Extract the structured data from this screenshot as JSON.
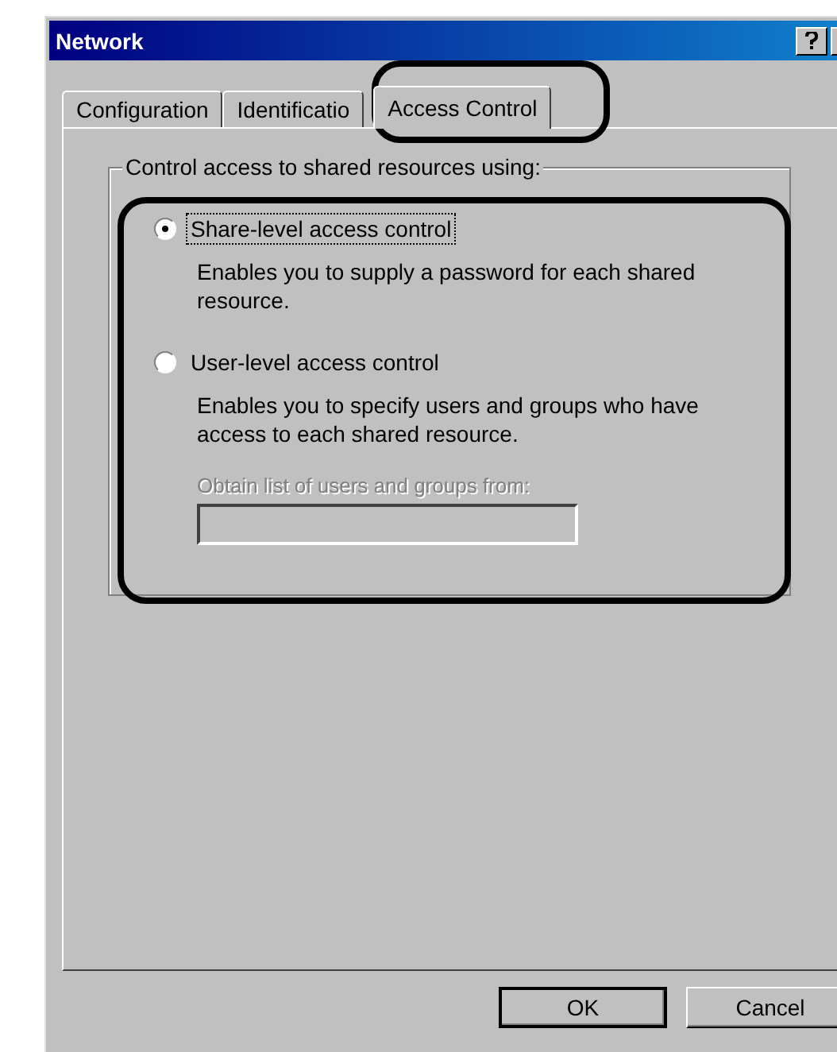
{
  "window": {
    "title": "Network"
  },
  "tabs": [
    {
      "label": "Configuration",
      "selected": false
    },
    {
      "label": "Identificatio",
      "selected": false
    },
    {
      "label": "Access Control",
      "selected": true
    }
  ],
  "group": {
    "title": "Control access to shared resources using:",
    "options": [
      {
        "label": "Share-level access control",
        "selected": true,
        "description": "Enables you to supply a password for each shared resource."
      },
      {
        "label": "User-level access control",
        "selected": false,
        "description": "Enables you to specify users and groups who have access to each shared resource."
      }
    ],
    "source": {
      "label": "Obtain list of users and groups from:",
      "disabled": true
    }
  },
  "buttons": [
    {
      "label": "OK",
      "default": true
    },
    {
      "label": "Cancel",
      "default": false
    }
  ]
}
